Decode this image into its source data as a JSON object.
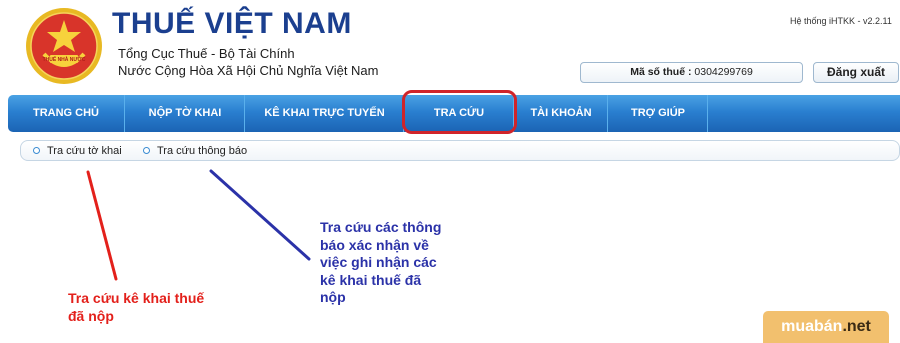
{
  "header": {
    "title": "THUẾ VIỆT NAM",
    "subtitle_1": "Tổng Cục Thuế - Bộ Tài Chính",
    "subtitle_2": "Nước Cộng Hòa Xã Hội Chủ Nghĩa Việt Nam",
    "emblem_text": "THUẾ NHÀ NƯỚC",
    "system_version": "Hệ thống iHTKK - v2.2.11",
    "tax_code_label": "Mã số thuế :",
    "tax_code_value": "0304299769",
    "logout_label": "Đăng xuất"
  },
  "nav": {
    "items": [
      {
        "label": "TRANG CHỦ"
      },
      {
        "label": "NỘP TỜ KHAI"
      },
      {
        "label": "KÊ KHAI TRỰC TUYẾN"
      },
      {
        "label": "TRA CỨU"
      },
      {
        "label": "TÀI KHOẢN"
      },
      {
        "label": "TRỢ GIÚP"
      }
    ]
  },
  "subnav": {
    "items": [
      {
        "label": "Tra cứu tờ khai"
      },
      {
        "label": "Tra cứu thông báo"
      }
    ]
  },
  "annotations": {
    "red_note": "Tra cứu kê khai thuế đã nộp",
    "blue_note": "Tra cứu các thông báo xác nhận về việc ghi nhận các kê khai thuế đã nộp"
  },
  "watermark": {
    "part_1": "muabán",
    "part_2": ".net"
  },
  "colors": {
    "brand_blue": "#1b3f8f",
    "nav_blue": "#2a7fd0",
    "highlight_red": "#d0242a",
    "annotation_red": "#e3201b",
    "annotation_blue": "#2b32a8",
    "watermark_bg": "#f2c06e"
  }
}
